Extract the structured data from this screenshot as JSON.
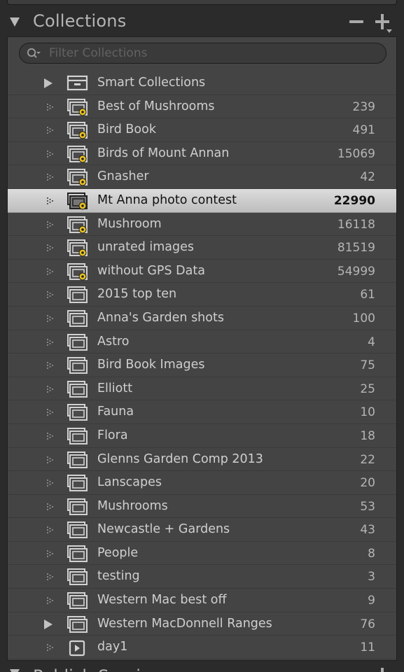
{
  "panel": {
    "title": "Collections",
    "search_placeholder": "Filter Collections"
  },
  "collections": [
    {
      "name": "Smart Collections",
      "count": "",
      "type": "smart-set",
      "expander": "expanded-arrow",
      "selected": false
    },
    {
      "name": "Best of Mushrooms",
      "count": "239",
      "type": "smart",
      "expander": "dotted",
      "selected": false
    },
    {
      "name": "Bird Book",
      "count": "491",
      "type": "smart",
      "expander": "dotted",
      "selected": false
    },
    {
      "name": "Birds of Mount Annan",
      "count": "15069",
      "type": "smart",
      "expander": "dotted",
      "selected": false
    },
    {
      "name": "Gnasher",
      "count": "42",
      "type": "smart",
      "expander": "dotted",
      "selected": false
    },
    {
      "name": "Mt Anna photo contest",
      "count": "22990",
      "type": "smart",
      "expander": "dotted",
      "selected": true
    },
    {
      "name": "Mushroom",
      "count": "16118",
      "type": "smart",
      "expander": "dotted",
      "selected": false
    },
    {
      "name": "unrated images",
      "count": "81519",
      "type": "smart",
      "expander": "dotted",
      "selected": false
    },
    {
      "name": "without GPS Data",
      "count": "54999",
      "type": "smart",
      "expander": "dotted",
      "selected": false
    },
    {
      "name": "2015 top ten",
      "count": "61",
      "type": "regular",
      "expander": "dotted",
      "selected": false
    },
    {
      "name": "Anna's Garden shots",
      "count": "100",
      "type": "regular",
      "expander": "dotted",
      "selected": false
    },
    {
      "name": "Astro",
      "count": "4",
      "type": "regular",
      "expander": "dotted",
      "selected": false
    },
    {
      "name": "Bird Book Images",
      "count": "75",
      "type": "regular",
      "expander": "dotted",
      "selected": false
    },
    {
      "name": "Elliott",
      "count": "25",
      "type": "regular",
      "expander": "dotted",
      "selected": false
    },
    {
      "name": "Fauna",
      "count": "10",
      "type": "regular",
      "expander": "dotted",
      "selected": false
    },
    {
      "name": "Flora",
      "count": "18",
      "type": "regular",
      "expander": "dotted",
      "selected": false
    },
    {
      "name": "Glenns Garden Comp 2013",
      "count": "22",
      "type": "regular",
      "expander": "dotted",
      "selected": false
    },
    {
      "name": "Lanscapes",
      "count": "20",
      "type": "regular",
      "expander": "dotted",
      "selected": false
    },
    {
      "name": "Mushrooms",
      "count": "53",
      "type": "regular",
      "expander": "dotted",
      "selected": false
    },
    {
      "name": "Newcastle + Gardens",
      "count": "43",
      "type": "regular",
      "expander": "dotted",
      "selected": false
    },
    {
      "name": "People",
      "count": "8",
      "type": "regular",
      "expander": "dotted",
      "selected": false
    },
    {
      "name": "testing",
      "count": "3",
      "type": "regular",
      "expander": "dotted",
      "selected": false
    },
    {
      "name": "Western Mac best off",
      "count": "9",
      "type": "regular",
      "expander": "dotted",
      "selected": false
    },
    {
      "name": "Western MacDonnell Ranges",
      "count": "76",
      "type": "regular",
      "expander": "arrow",
      "selected": false
    },
    {
      "name": "day1",
      "count": "11",
      "type": "video",
      "expander": "dotted",
      "selected": false
    }
  ],
  "next_panel": {
    "title": "Publish Services"
  },
  "colors": {
    "panel_bg": "#444444",
    "outer_bg": "#2b2b2b",
    "selected_row": "#d0d0d0",
    "smart_badge": "#e8c020"
  }
}
